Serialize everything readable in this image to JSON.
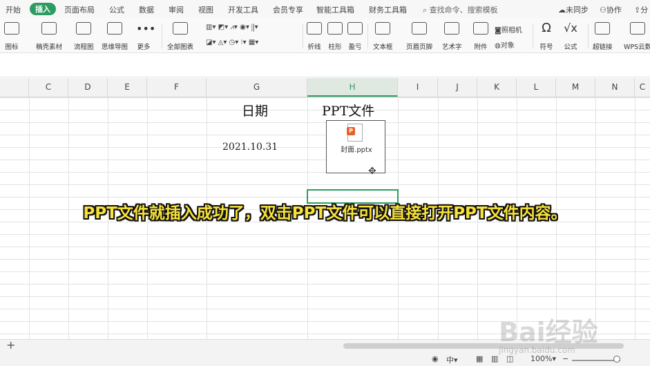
{
  "menubar": {
    "items": [
      "开始",
      "插入",
      "页面布局",
      "公式",
      "数据",
      "审阅",
      "视图",
      "开发工具",
      "会员专享",
      "智能工具箱",
      "财务工具箱"
    ],
    "active_index": 1,
    "search_label": "查找命令、搜索模板",
    "right": [
      "未同步",
      "协作",
      "分"
    ]
  },
  "ribbon": {
    "buttons": [
      "图标",
      "稿壳素材",
      "流程图",
      "思维导图",
      "更多",
      "全部图表",
      "折线",
      "柱形",
      "盈亏",
      "文本框",
      "页眉页脚",
      "艺术字",
      "附件",
      "对象",
      "符号",
      "公式",
      "超链接",
      "WPS云数"
    ],
    "extra": [
      "照相机"
    ]
  },
  "columns": [
    "C",
    "D",
    "E",
    "F",
    "G",
    "H",
    "I",
    "J",
    "K",
    "L",
    "M",
    "N",
    "C"
  ],
  "selected_column": "H",
  "cells": {
    "header_date": "日期",
    "header_ppt": "PPT文件",
    "date_value": "2021.10.31",
    "file_name": "封面.pptx",
    "file_badge": "P"
  },
  "caption": "PPT文件就插入成功了，双击PPT文件可以直接打开PPT文件内容。",
  "sheetbar": {
    "add": "+"
  },
  "status": {
    "input_mode": "中",
    "zoom": "100%",
    "zoom_minus": "−"
  },
  "watermark": {
    "brand": "Bai经验",
    "url": "jingyan.baidu.com"
  },
  "colors": {
    "accent": "#2e9b62",
    "caption": "#f7e13a",
    "ppt_badge": "#e8622b"
  }
}
